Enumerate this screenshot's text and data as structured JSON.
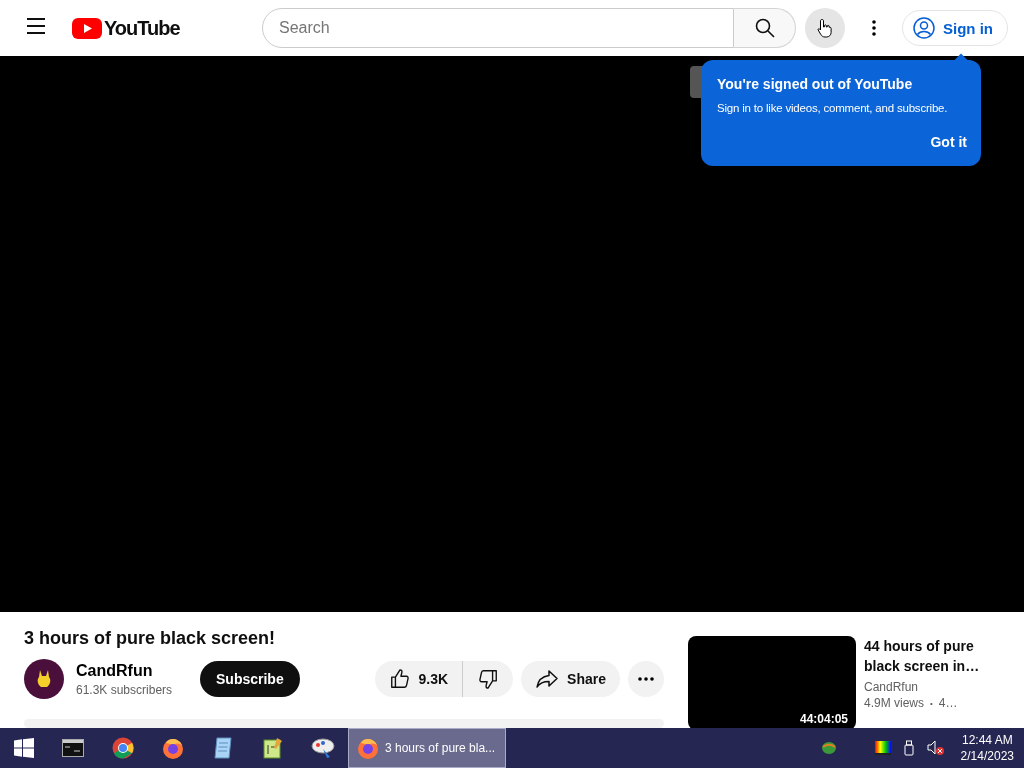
{
  "header": {
    "logo": "YouTube",
    "search": {
      "placeholder": "Search"
    },
    "sign_in": "Sign in"
  },
  "popup": {
    "title": "You're signed out of YouTube",
    "message": "Sign in to like videos, comment, and subscribe.",
    "button": "Got it"
  },
  "video": {
    "title": "3 hours of pure black screen!",
    "channel": "CandRfun",
    "subscribers": "61.3K subscribers",
    "subscribe": "Subscribe",
    "likes": "9.3K",
    "share": "Share"
  },
  "related": [
    {
      "title": "44 hours of pure black screen in…",
      "channel": "CandRfun",
      "meta": "4.9M views",
      "separator": "•",
      "meta_2": "4…",
      "duration": "44:04:05"
    }
  ],
  "taskbar": {
    "apps": [
      {
        "kind": "terminal",
        "selected": false
      },
      {
        "kind": "chrome",
        "selected": false
      },
      {
        "kind": "firefox",
        "selected": false
      },
      {
        "kind": "notepad",
        "selected": false
      },
      {
        "kind": "editor",
        "selected": false
      },
      {
        "kind": "paint",
        "selected": false
      },
      {
        "kind": "firefox",
        "selected": true,
        "label": "3 hours of pure bla..."
      }
    ],
    "time": "12:44 AM",
    "date": "2/14/2023"
  }
}
